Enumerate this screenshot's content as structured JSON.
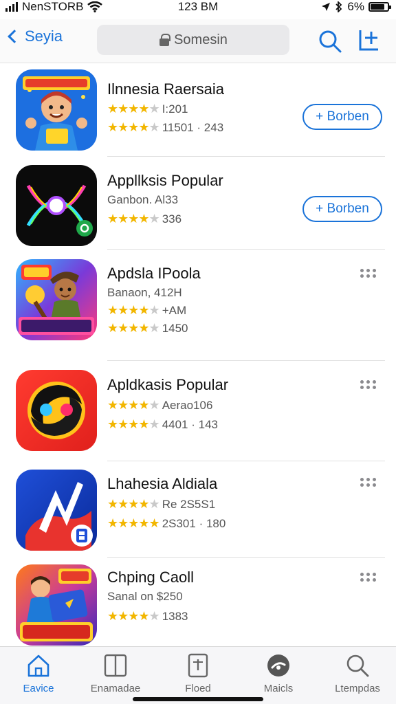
{
  "status_bar": {
    "carrier": "NenSTORB",
    "time": "123 BM",
    "battery": "6%"
  },
  "nav": {
    "back_label": "Seyia",
    "search_placeholder": "Somesin"
  },
  "apps": [
    {
      "name": "Ilnnesia Raersaia",
      "line1": "I:201",
      "line1_rating": 4,
      "line2": "11501 · 243",
      "line2_rating": 4,
      "action": "button",
      "action_label": "+ Borben"
    },
    {
      "name": "Appllksis Popular",
      "line1": "Ganbon. Al33",
      "line1_rating": null,
      "line2": "336",
      "line2_rating": 4,
      "action": "button",
      "action_label": "+ Borben"
    },
    {
      "name": "Apdsla IPoola",
      "line1": "Banaon, 412H",
      "line1_rating": null,
      "line1b": "+AM",
      "line1b_rating": 4,
      "line2": "1450",
      "line2_rating": 4,
      "action": "more"
    },
    {
      "name": "Apldkasis Popular",
      "line1": "Aerao106",
      "line1_rating": 4,
      "line2": "4401 · 143",
      "line2_rating": 4,
      "action": "more"
    },
    {
      "name": "Lhahesia Aldiala",
      "line1": "Re 2S5S1",
      "line1_rating": 4,
      "line2": "2S301 · 180",
      "line2_rating": 5,
      "action": "more"
    },
    {
      "name": "Chping Caoll",
      "line1": "Sanal on $250",
      "line1_rating": null,
      "line2": "1383",
      "line2_rating": 4,
      "action": "more"
    }
  ],
  "tabs": [
    {
      "label": "Eavice",
      "icon": "home-icon",
      "active": true
    },
    {
      "label": "Enamadae",
      "icon": "book-icon",
      "active": false
    },
    {
      "label": "Floed",
      "icon": "document-icon",
      "active": false
    },
    {
      "label": "Maicls",
      "icon": "gauge-icon",
      "active": false
    },
    {
      "label": "Ltempdas",
      "icon": "search-icon",
      "active": false
    }
  ],
  "colors": {
    "accent": "#1a73d9",
    "star": "#f2b600"
  }
}
